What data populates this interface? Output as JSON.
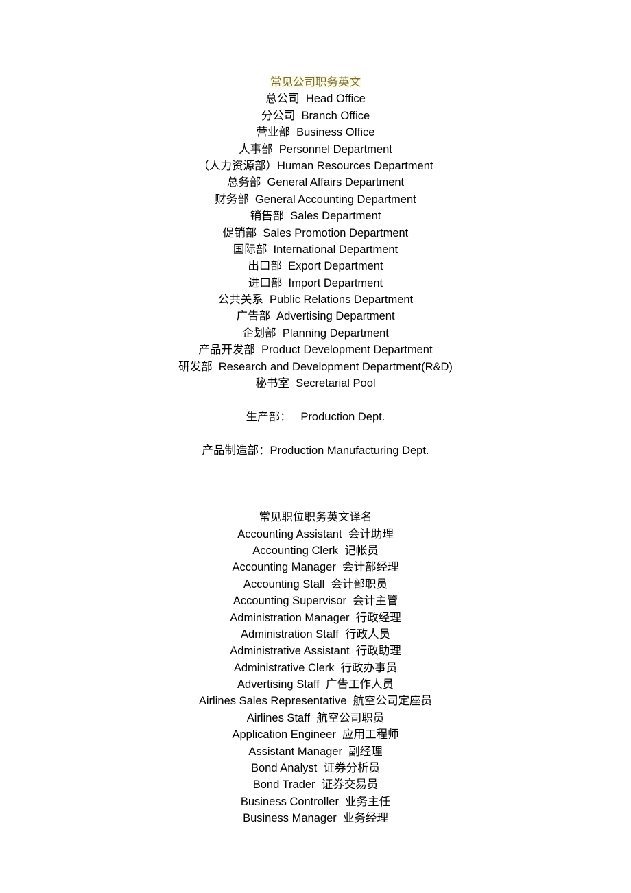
{
  "document": {
    "background_color": "#ffffff",
    "text_color": "#000000",
    "alignment": "center"
  },
  "section1": {
    "title": "常见公司职务英文",
    "title_highlight_color": "#fbfbe8",
    "title_text_color": "#7a6f33",
    "entries": [
      "总公司  Head Office",
      "分公司  Branch Office",
      "营业部  Business Office",
      "人事部  Personnel Department",
      "（人力资源部）Human Resources Department",
      "总务部  General Affairs Department",
      "财务部  General Accounting Department",
      "销售部  Sales Department",
      "促销部  Sales Promotion Department",
      "国际部  International Department",
      "出口部  Export Department",
      "进口部  Import Department",
      "公共关系  Public Relations Department",
      "广告部  Advertising Department",
      "企划部  Planning Department",
      "产品开发部  Product Development Department",
      "研发部  Research and Development Department(R&D)",
      "秘书室  Secretarial Pool"
    ],
    "extra_entries": [
      "生产部：   Production Dept.",
      "产品制造部：Production Manufacturing Dept."
    ]
  },
  "section2": {
    "title": "常见职位职务英文译名",
    "entries": [
      "Accounting Assistant  会计助理",
      "Accounting Clerk  记帐员",
      "Accounting Manager  会计部经理",
      "Accounting Stall  会计部职员",
      "Accounting Supervisor  会计主管",
      "Administration Manager  行政经理",
      "Administration Staff  行政人员",
      "Administrative Assistant  行政助理",
      "Administrative Clerk  行政办事员",
      "Advertising Staff  广告工作人员",
      "Airlines Sales Representative  航空公司定座员",
      "Airlines Staff  航空公司职员",
      "Application Engineer  应用工程师",
      "Assistant Manager  副经理",
      "Bond Analyst  证券分析员",
      "Bond Trader  证券交易员",
      "Business Controller  业务主任",
      "Business Manager  业务经理"
    ]
  }
}
